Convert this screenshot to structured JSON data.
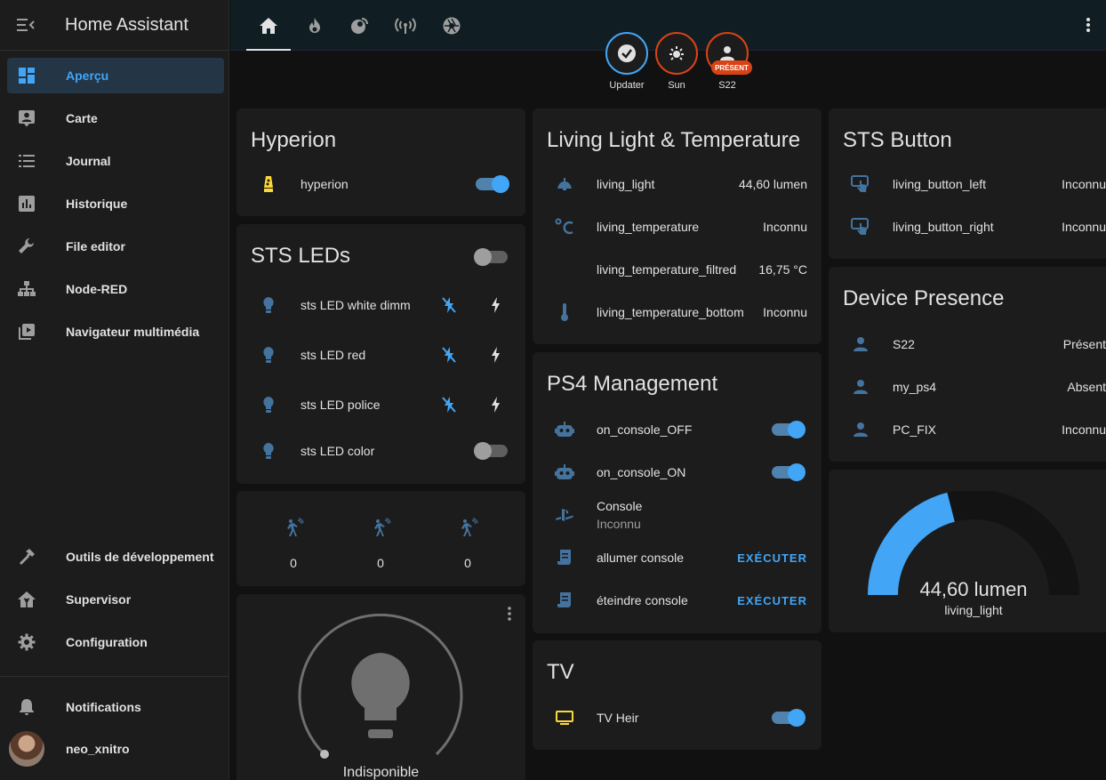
{
  "app": {
    "title": "Home Assistant"
  },
  "sidebar": {
    "items": [
      {
        "label": "Aperçu",
        "icon": "dashboard-icon",
        "active": true
      },
      {
        "label": "Carte",
        "icon": "map-account-icon"
      },
      {
        "label": "Journal",
        "icon": "list-icon"
      },
      {
        "label": "Historique",
        "icon": "chart-box-icon"
      },
      {
        "label": "File editor",
        "icon": "wrench-icon"
      },
      {
        "label": "Node-RED",
        "icon": "sitemap-icon"
      },
      {
        "label": "Navigateur multimédia",
        "icon": "play-box-multiple-icon"
      }
    ],
    "bottom_items": [
      {
        "label": "Outils de développement",
        "icon": "hammer-icon"
      },
      {
        "label": "Supervisor",
        "icon": "home-assistant-icon"
      },
      {
        "label": "Configuration",
        "icon": "cog-icon"
      }
    ],
    "notifications": "Notifications",
    "user": "neo_xnitro"
  },
  "badges": [
    {
      "label": "Updater",
      "icon": "check-circle-icon",
      "border": "#42a5f5"
    },
    {
      "label": "Sun",
      "icon": "sun-icon",
      "border": "#d84315"
    },
    {
      "label": "S22",
      "icon": "account-icon",
      "border": "#d84315",
      "chip": "PRÉSENT"
    }
  ],
  "hyperion": {
    "title": "Hyperion",
    "entities": [
      {
        "name": "hyperion",
        "on": true
      }
    ]
  },
  "sts_leds": {
    "title": "STS LEDs",
    "header_toggle_on": false,
    "entities": [
      {
        "name": "sts LED white dimm"
      },
      {
        "name": "sts LED red"
      },
      {
        "name": "sts LED police"
      },
      {
        "name": "sts LED color",
        "on": false
      }
    ]
  },
  "motion": {
    "values": [
      "0",
      "0",
      "0"
    ]
  },
  "light_card": {
    "state": "Indisponible"
  },
  "living": {
    "title": "Living Light & Temperature",
    "entities": [
      {
        "name": "living_light",
        "state": "44,60 lumen"
      },
      {
        "name": "living_temperature",
        "state": "Inconnu"
      },
      {
        "name": "living_temperature_filtred",
        "state": "16,75 °C"
      },
      {
        "name": "living_temperature_bottom",
        "state": "Inconnu"
      }
    ]
  },
  "ps4": {
    "title": "PS4 Management",
    "entities": [
      {
        "name": "on_console_OFF",
        "on": true
      },
      {
        "name": "on_console_ON",
        "on": true
      },
      {
        "name": "Console",
        "secondary": "Inconnu"
      },
      {
        "name": "allumer console",
        "action": "EXÉCUTER"
      },
      {
        "name": "éteindre console",
        "action": "EXÉCUTER"
      }
    ]
  },
  "tv": {
    "title": "TV",
    "entities": [
      {
        "name": "TV Heir",
        "on": true
      }
    ]
  },
  "sts_button": {
    "title": "STS Button",
    "entities": [
      {
        "name": "living_button_left",
        "state": "Inconnu"
      },
      {
        "name": "living_button_right",
        "state": "Inconnu"
      }
    ]
  },
  "presence": {
    "title": "Device Presence",
    "entities": [
      {
        "name": "S22",
        "state": "Présent"
      },
      {
        "name": "my_ps4",
        "state": "Absent"
      },
      {
        "name": "PC_FIX",
        "state": "Inconnu"
      }
    ]
  },
  "gauge": {
    "value": "44,60 lumen",
    "name": "living_light",
    "fraction": 0.42
  },
  "colors": {
    "accent": "#42a5f5",
    "warning": "#d84315",
    "card": "#1c1c1c",
    "background": "#111111"
  }
}
